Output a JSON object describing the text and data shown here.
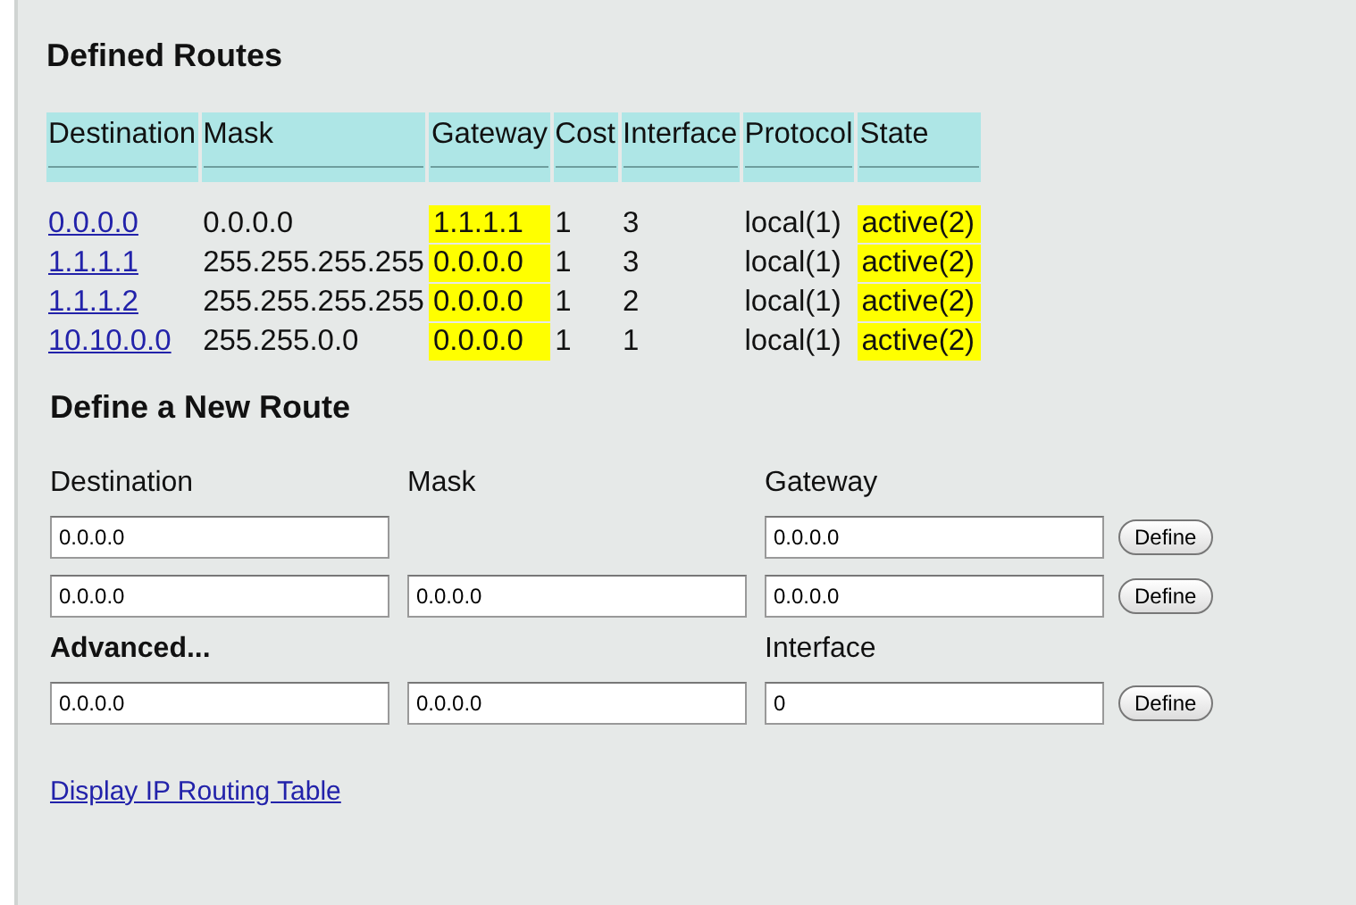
{
  "routes": {
    "title": "Defined Routes",
    "columns": [
      {
        "label": "Destination",
        "kind": "link"
      },
      {
        "label": "Mask",
        "kind": "plain"
      },
      {
        "label": "Gateway",
        "kind": "highlight"
      },
      {
        "label": "Cost",
        "kind": "plain"
      },
      {
        "label": "Interface",
        "kind": "plain"
      },
      {
        "label": "Protocol",
        "kind": "plain"
      },
      {
        "label": "State",
        "kind": "highlight"
      }
    ],
    "rows": [
      [
        "0.0.0.0",
        "0.0.0.0",
        "1.1.1.1",
        "1",
        "3",
        "local(1)",
        "active(2)"
      ],
      [
        "1.1.1.1",
        "255.255.255.255",
        "0.0.0.0",
        "1",
        "3",
        "local(1)",
        "active(2)"
      ],
      [
        "1.1.1.2",
        "255.255.255.255",
        "0.0.0.0",
        "1",
        "2",
        "local(1)",
        "active(2)"
      ],
      [
        "10.10.0.0",
        "255.255.0.0",
        "0.0.0.0",
        "1",
        "1",
        "local(1)",
        "active(2)"
      ]
    ]
  },
  "new_route": {
    "title": "Define a New Route",
    "lines": [
      {
        "kind": "labels",
        "items": [
          {
            "kind": "label",
            "text": "Destination"
          },
          {
            "kind": "label",
            "text": "Mask"
          },
          {
            "kind": "label",
            "text": "Gateway"
          }
        ]
      },
      {
        "kind": "fields",
        "items": [
          {
            "kind": "field",
            "value": "0.0.0.0"
          },
          {
            "kind": "empty"
          },
          {
            "kind": "field",
            "value": "0.0.0.0"
          }
        ],
        "button": "Define"
      },
      {
        "kind": "fields",
        "items": [
          {
            "kind": "field",
            "value": "0.0.0.0"
          },
          {
            "kind": "field",
            "value": "0.0.0.0"
          },
          {
            "kind": "field",
            "value": "0.0.0.0"
          }
        ],
        "button": "Define"
      },
      {
        "kind": "labels",
        "items": [
          {
            "kind": "heading",
            "text": "Advanced..."
          },
          {
            "kind": "empty"
          },
          {
            "kind": "label",
            "text": "Interface"
          }
        ]
      },
      {
        "kind": "fields",
        "items": [
          {
            "kind": "field",
            "value": "0.0.0.0"
          },
          {
            "kind": "field",
            "value": "0.0.0.0"
          },
          {
            "kind": "field",
            "value": "0"
          }
        ],
        "button": "Define"
      }
    ]
  },
  "link": "Display IP Routing Table"
}
